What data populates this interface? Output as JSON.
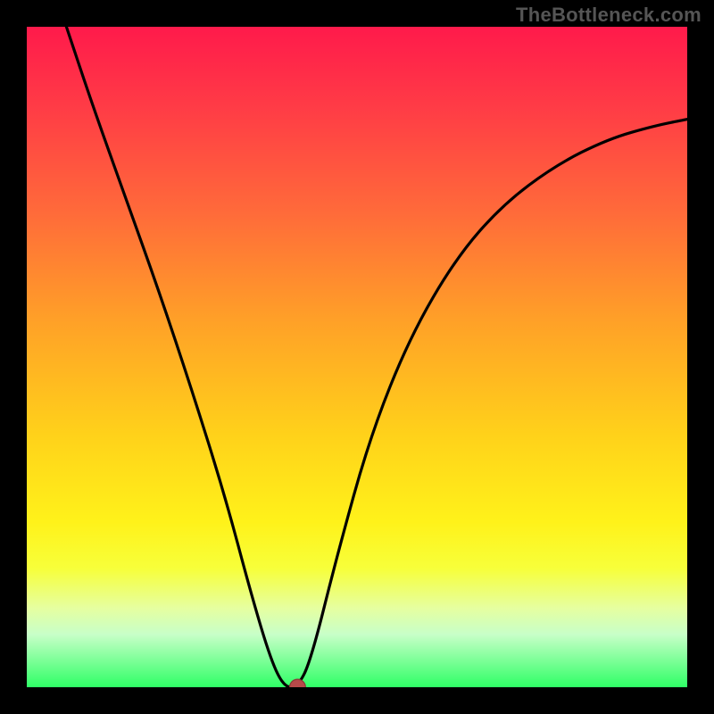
{
  "watermark": "TheBottleneck.com",
  "chart_data": {
    "type": "line",
    "title": "",
    "xlabel": "",
    "ylabel": "",
    "xlim": [
      0,
      1
    ],
    "ylim": [
      0,
      1
    ],
    "grid": false,
    "legend": false,
    "background": {
      "style": "vertical-gradient",
      "stops": [
        {
          "pos": 0.0,
          "color": "#ff1a4b"
        },
        {
          "pos": 0.28,
          "color": "#ff6a3a"
        },
        {
          "pos": 0.62,
          "color": "#ffd21a"
        },
        {
          "pos": 0.88,
          "color": "#e6ffa0"
        },
        {
          "pos": 1.0,
          "color": "#2fff66"
        }
      ]
    },
    "series": [
      {
        "name": "curve",
        "x": [
          0.06,
          0.1,
          0.15,
          0.2,
          0.25,
          0.3,
          0.34,
          0.37,
          0.39,
          0.41,
          0.43,
          0.47,
          0.52,
          0.58,
          0.65,
          0.72,
          0.8,
          0.88,
          0.95,
          1.0
        ],
        "y": [
          1.0,
          0.88,
          0.74,
          0.6,
          0.45,
          0.29,
          0.14,
          0.04,
          0.0,
          0.0,
          0.04,
          0.2,
          0.38,
          0.53,
          0.65,
          0.73,
          0.79,
          0.83,
          0.85,
          0.86
        ]
      }
    ],
    "marker": {
      "x": 0.41,
      "y": 0.0,
      "r": 0.012,
      "color": "#b74a4a"
    }
  }
}
